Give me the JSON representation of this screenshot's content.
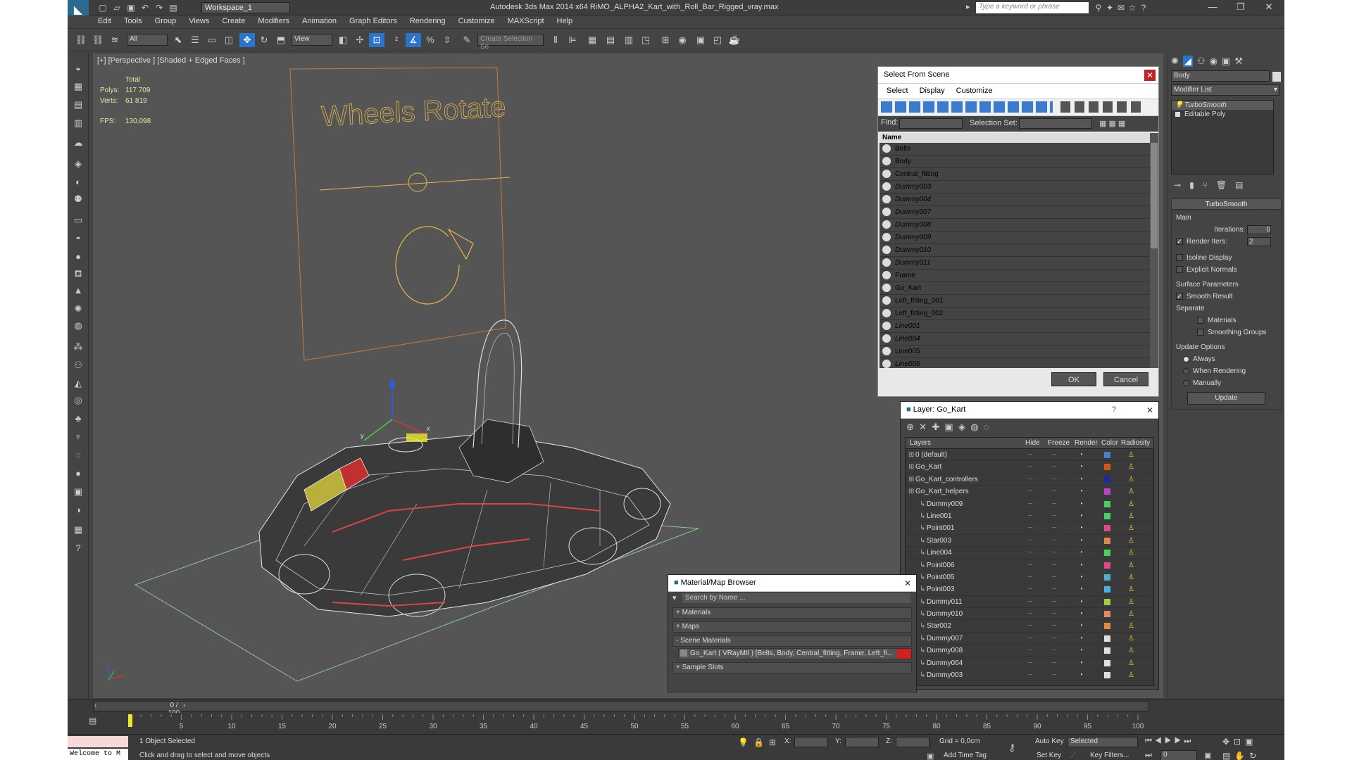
{
  "title_bar": {
    "workspace": "Workspace_1",
    "app_title": "Autodesk 3ds Max  2014 x64      RiMO_ALPHA2_Kart_with_Roll_Bar_Rigged_vray.max",
    "search_placeholder": "Type a keyword or phrase"
  },
  "menu": [
    "Edit",
    "Tools",
    "Group",
    "Views",
    "Create",
    "Modifiers",
    "Animation",
    "Graph Editors",
    "Rendering",
    "Customize",
    "MAXScript",
    "Help"
  ],
  "toolbar": {
    "filter": "All",
    "view": "View",
    "selection_set": "Create Selection Se"
  },
  "viewport": {
    "label": "[+] [Perspective ] [Shaded + Edged Faces ]",
    "stats": {
      "total": "Total",
      "polys_label": "Polys:",
      "polys": "117 709",
      "verts_label": "Verts:",
      "verts": "61 819",
      "fps_label": "FPS:",
      "fps": "130,098"
    },
    "sign_text": "Wheels Rotate",
    "accent": "#e8b84a"
  },
  "select_from_scene": {
    "title": "Select From Scene",
    "tabs": [
      "Select",
      "Display",
      "Customize"
    ],
    "find_label": "Find:",
    "selection_set_label": "Selection Set:",
    "column": "Name",
    "items": [
      "Belts",
      "Body",
      "Central_fitting",
      "Dummy003",
      "Dummy004",
      "Dummy007",
      "Dummy008",
      "Dummy009",
      "Dummy010",
      "Dummy011",
      "Frame",
      "Go_Kart",
      "Left_fitting_001",
      "Left_fitting_002",
      "Line001",
      "Line004",
      "Line005",
      "Line006"
    ],
    "ok": "OK",
    "cancel": "Cancel"
  },
  "layer_dialog": {
    "title": "Layer: Go_Kart",
    "help": "?",
    "columns": [
      "Layers",
      "Hide",
      "Freeze",
      "Render",
      "Color",
      "Radiosity"
    ],
    "rows": [
      {
        "name": "0 (default)",
        "color": "#4a7fd0"
      },
      {
        "name": "Go_Kart",
        "color": "#d05a1a"
      },
      {
        "name": "Go_Kart_controllers",
        "color": "#1a2aa0"
      },
      {
        "name": "Go_Kart_helpers",
        "color": "#c040d0"
      },
      {
        "name": "Dummy009",
        "color": "#4ad060"
      },
      {
        "name": "Line001",
        "color": "#4ad060"
      },
      {
        "name": "Point001",
        "color": "#e04a8a"
      },
      {
        "name": "Star003",
        "color": "#e08a4a"
      },
      {
        "name": "Line004",
        "color": "#4ad060"
      },
      {
        "name": "Point006",
        "color": "#e04a8a"
      },
      {
        "name": "Point005",
        "color": "#4ab0d0"
      },
      {
        "name": "Point003",
        "color": "#4ab0e0"
      },
      {
        "name": "Dummy011",
        "color": "#a0d040"
      },
      {
        "name": "Dummy010",
        "color": "#e08a6a"
      },
      {
        "name": "Star002",
        "color": "#e08a4a"
      },
      {
        "name": "Dummy007",
        "color": "#e0e0e0"
      },
      {
        "name": "Dummy008",
        "color": "#e0e0e0"
      },
      {
        "name": "Dummy004",
        "color": "#e0e0e0"
      },
      {
        "name": "Dummy003",
        "color": "#e0e0e0"
      }
    ]
  },
  "material_browser": {
    "title": "Material/Map Browser",
    "search_placeholder": "Search by Name ...",
    "sections": [
      "+ Materials",
      "+ Maps",
      "- Scene Materials",
      "+ Sample Slots"
    ],
    "scene_material": "Go_Kart  ( VRayMtl ) [Belts, Body, Central_fitting, Frame, Left_fi..."
  },
  "command_panel": {
    "object_name": "Body",
    "modifier_list": "Modifier List",
    "stack": [
      "TurboSmooth",
      "Editable Poly"
    ],
    "rollout": "TurboSmooth",
    "main": "Main",
    "iterations_label": "Iterations:",
    "iterations": "0",
    "render_iters_label": "Render Iters:",
    "render_iters": "2",
    "isoline": "Isoline Display",
    "explicit": "Explicit Normals",
    "surface": "Surface Parameters",
    "smooth_result": "Smooth Result",
    "separate": "Separate",
    "materials": "Materials",
    "smoothing_groups": "Smoothing Groups",
    "update_options": "Update Options",
    "always": "Always",
    "when_rendering": "When Rendering",
    "manually": "Manually",
    "update": "Update"
  },
  "timeline": {
    "frame": "0 / 100",
    "ticks": [
      "5",
      "10",
      "15",
      "20",
      "25",
      "30",
      "35",
      "40",
      "45",
      "50",
      "55",
      "60",
      "65",
      "70",
      "75",
      "80",
      "85",
      "90",
      "95",
      "100"
    ]
  },
  "status": {
    "selected": "1 Object Selected",
    "prompt": "Click and drag to select and move objects",
    "welcome": "Welcome to M",
    "x": "X:",
    "y": "Y:",
    "z": "Z:",
    "grid": "Grid = 0,0cm",
    "auto_key": "Auto Key",
    "selected_mode": "Selected",
    "set_key": "Set Key",
    "key_filters": "Key Filters...",
    "add_time_tag": "Add Time Tag",
    "frame_field": "0"
  }
}
